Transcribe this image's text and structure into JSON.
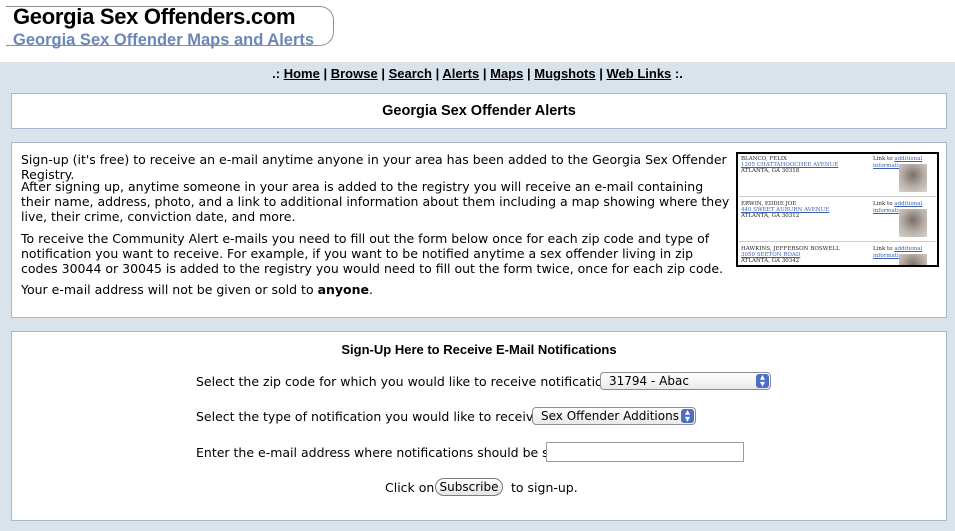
{
  "header": {
    "site_title": "Georgia Sex Offenders.com",
    "site_subtitle": "Georgia Sex Offender Maps and Alerts"
  },
  "nav": {
    "prefix": ".:",
    "suffix": ":.",
    "separator": "|",
    "items": [
      "Home",
      "Browse",
      "Search",
      "Alerts",
      "Maps",
      "Mugshots",
      "Web Links"
    ]
  },
  "page_title": "Georgia Sex Offender Alerts",
  "info": {
    "p1": "Sign-up (it's free) to receive an e-mail anytime anyone in your area has been added to the Georgia Sex Offender Registry.",
    "p2": "After signing up, anytime someone in your area is added to the registry you will receive an e-mail containing their name, address, photo, and a link to additional information about them including a map showing where they live, their crime, conviction date, and more.",
    "p3": "To receive the Community Alert e-mails you need to fill out the form below once for each zip code and type of notification you want to receive. For example, if you want to be notified anytime a sex offender living in zip codes 30044 or 30045 is added to the registry you would need to fill out the form twice, once for each zip code.",
    "p4_before": "Your e-mail address will not be given or sold to ",
    "p4_bold": "anyone",
    "p4_after": "."
  },
  "sample_entries": [
    {
      "name": "BLANCO, FELIX",
      "address": "1205 CHATTAHOOCHEE AVENUE",
      "city": "ATLANTA, GA 30318",
      "link_prefix": "Link to ",
      "link": "additional information"
    },
    {
      "name": "ERWIN, EDDIE JOE",
      "address": "440 SWEET AUBURN AVENUE",
      "city": "ATLANTA, GA 30312",
      "link_prefix": "Link to ",
      "link": "additional information"
    },
    {
      "name": "HAWKINS, JEFFERSON BOSWELL",
      "address": "3050 SEETON ROAD",
      "city": "ATLANTA, GA 30342",
      "link_prefix": "Link to ",
      "link": "additional information"
    }
  ],
  "signup": {
    "heading": "Sign-Up Here to Receive E-Mail Notifications",
    "zip_label": "Select the zip code for which you would like to receive notifications:",
    "zip_value": "31794 - Abac",
    "type_label": "Select the type of notification you would like to receive:",
    "type_value": "Sex Offender Additions",
    "email_label": "Enter the e-mail address where notifications should be sent:",
    "email_value": "",
    "click_label": "Click on",
    "subscribe_button": "Subscribe",
    "after_button": "to sign-up."
  }
}
